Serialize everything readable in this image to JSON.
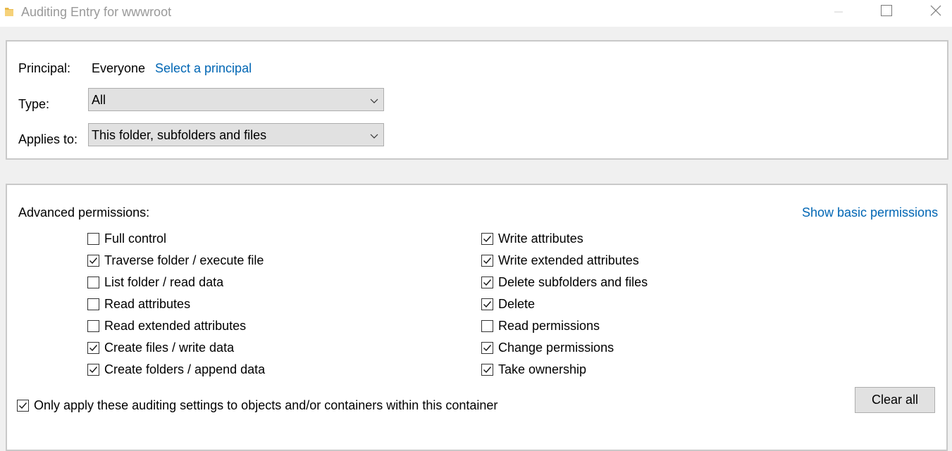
{
  "window": {
    "title": "Auditing Entry for wwwroot",
    "icon": "folder-icon"
  },
  "principal": {
    "label": "Principal:",
    "value": "Everyone",
    "link": "Select a principal"
  },
  "type": {
    "label": "Type:",
    "value": "All"
  },
  "applies_to": {
    "label": "Applies to:",
    "value": "This folder, subfolders and files"
  },
  "advanced": {
    "heading": "Advanced permissions:",
    "toggle_link": "Show basic permissions",
    "left_column": [
      {
        "label": "Full control",
        "checked": false
      },
      {
        "label": "Traverse folder / execute file",
        "checked": true
      },
      {
        "label": "List folder / read data",
        "checked": false
      },
      {
        "label": "Read attributes",
        "checked": false
      },
      {
        "label": "Read extended attributes",
        "checked": false
      },
      {
        "label": "Create files / write data",
        "checked": true
      },
      {
        "label": "Create folders / append data",
        "checked": true
      }
    ],
    "right_column": [
      {
        "label": "Write attributes",
        "checked": true
      },
      {
        "label": "Write extended attributes",
        "checked": true
      },
      {
        "label": "Delete subfolders and files",
        "checked": true
      },
      {
        "label": "Delete",
        "checked": true
      },
      {
        "label": "Read permissions",
        "checked": false
      },
      {
        "label": "Change permissions",
        "checked": true
      },
      {
        "label": "Take ownership",
        "checked": true
      }
    ]
  },
  "only_apply": {
    "label": "Only apply these auditing settings to objects and/or containers within this container",
    "checked": true
  },
  "clear_all": {
    "label": "Clear all"
  },
  "colors": {
    "link": "#0066b4",
    "title_text": "#999999",
    "folder": "#f2c94c"
  }
}
